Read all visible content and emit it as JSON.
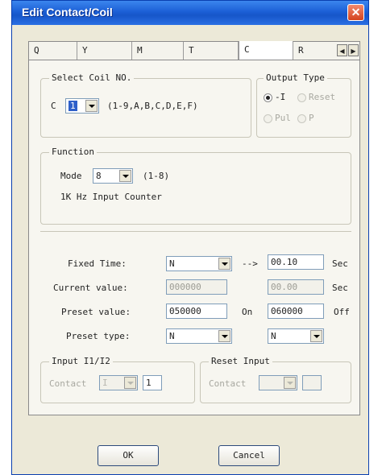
{
  "window": {
    "title": "Edit Contact/Coil",
    "close_glyph": "✕"
  },
  "tabs": [
    {
      "label": "Q"
    },
    {
      "label": "Y"
    },
    {
      "label": "M"
    },
    {
      "label": "T"
    },
    {
      "label": "C",
      "active": true
    },
    {
      "label": "R"
    }
  ],
  "tab_scroll": {
    "left": "◀",
    "right": "▶"
  },
  "select_coil": {
    "legend": "Select Coil NO.",
    "prefix": "C",
    "value": "1",
    "range": "(1-9,A,B,C,D,E,F)"
  },
  "output_type": {
    "legend": "Output Type",
    "options": [
      "-I",
      "Reset",
      "Pul",
      "P"
    ],
    "selected": "-I"
  },
  "function": {
    "legend": "Function",
    "mode_label": "Mode",
    "mode_value": "8",
    "mode_range": "(1-8)",
    "description": "1K Hz Input Counter"
  },
  "timing": {
    "fixed_time_label": "Fixed Time:",
    "fixed_time_value": "N",
    "arrow_text": "-->",
    "fixed_time_target": "00.10",
    "sec1": "Sec",
    "current_label": "Current value:",
    "current_value": "000000",
    "current_time": "00.00",
    "sec2": "Sec",
    "preset_label": "Preset value:",
    "preset_value": "050000",
    "on_label": "On",
    "preset_off_value": "060000",
    "off_label": "Off",
    "preset_type_label": "Preset type:",
    "preset_type_value": "N",
    "preset_type_value2": "N"
  },
  "input_group": {
    "legend": "Input I1/I2",
    "contact_label": "Contact",
    "contact_select": "I",
    "contact_value": "1"
  },
  "reset_group": {
    "legend": "Reset Input",
    "contact_label": "Contact",
    "contact_select": "",
    "contact_value": ""
  },
  "buttons": {
    "ok": "OK",
    "cancel": "Cancel"
  }
}
